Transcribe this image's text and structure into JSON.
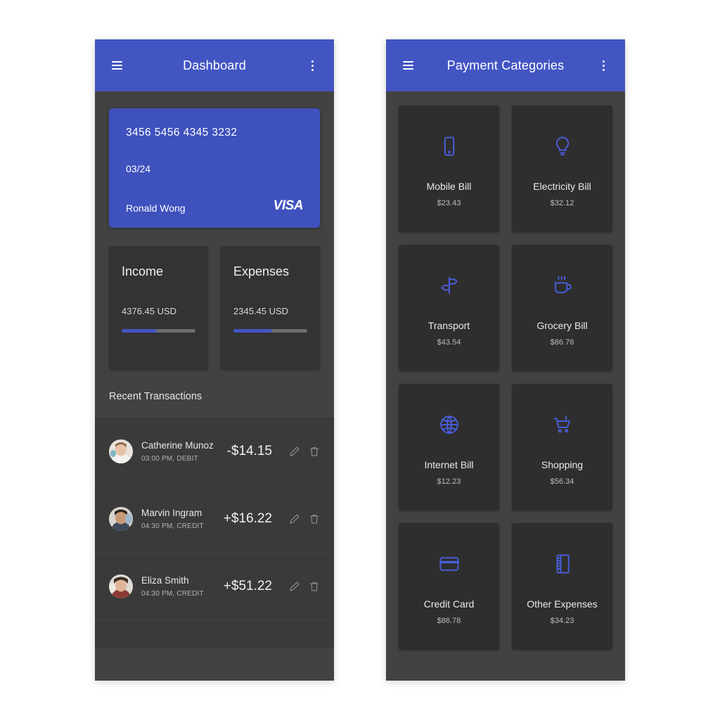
{
  "theme": {
    "accent": "#4355c2",
    "card_blue": "#3e51bd",
    "screen_bg": "#424242",
    "tile_bg": "#2e2e2e",
    "stat_bg": "#333333"
  },
  "dashboard": {
    "appbar": {
      "title": "Dashboard",
      "menu_icon": "hamburger-icon",
      "overflow_icon": "kebab-menu-icon"
    },
    "credit_card": {
      "number": "3456 5456 4345 3232",
      "expiry": "03/24",
      "holder": "Ronald Wong",
      "brand": "VISA"
    },
    "stats": [
      {
        "title": "Income",
        "value": "4376.45 USD",
        "progress": 48
      },
      {
        "title": "Expenses",
        "value": "2345.45 USD",
        "progress": 52
      }
    ],
    "transactions_title": "Recent Transactions",
    "transactions": [
      {
        "name": "Catherine Munoz",
        "meta": "03:00 PM, DEBIT",
        "amount": "-$14.15",
        "edit_icon": "pencil-icon",
        "delete_icon": "trash-icon"
      },
      {
        "name": "Marvin Ingram",
        "meta": "04:30 PM, CREDIT",
        "amount": "+$16.22",
        "edit_icon": "pencil-icon",
        "delete_icon": "trash-icon"
      },
      {
        "name": "Eliza Smith",
        "meta": "04:30 PM, CREDIT",
        "amount": "+$51.22",
        "edit_icon": "pencil-icon",
        "delete_icon": "trash-icon"
      }
    ]
  },
  "categories_screen": {
    "appbar": {
      "title": "Payment Categories",
      "menu_icon": "hamburger-icon",
      "overflow_icon": "kebab-menu-icon"
    },
    "categories": [
      {
        "label": "Mobile Bill",
        "amount": "$23.43",
        "icon": "smartphone-icon"
      },
      {
        "label": "Electricity Bill",
        "amount": "$32.12",
        "icon": "lightbulb-icon"
      },
      {
        "label": "Transport",
        "amount": "$43.54",
        "icon": "signpost-icon"
      },
      {
        "label": "Grocery Bill",
        "amount": "$86.76",
        "icon": "coffee-mug-icon"
      },
      {
        "label": "Internet Bill",
        "amount": "$12.23",
        "icon": "globe-icon"
      },
      {
        "label": "Shopping",
        "amount": "$56.34",
        "icon": "shopping-cart-icon"
      },
      {
        "label": "Credit Card",
        "amount": "$86.78",
        "icon": "credit-card-icon"
      },
      {
        "label": "Other Expenses",
        "amount": "$34.23",
        "icon": "notebook-icon"
      }
    ]
  }
}
